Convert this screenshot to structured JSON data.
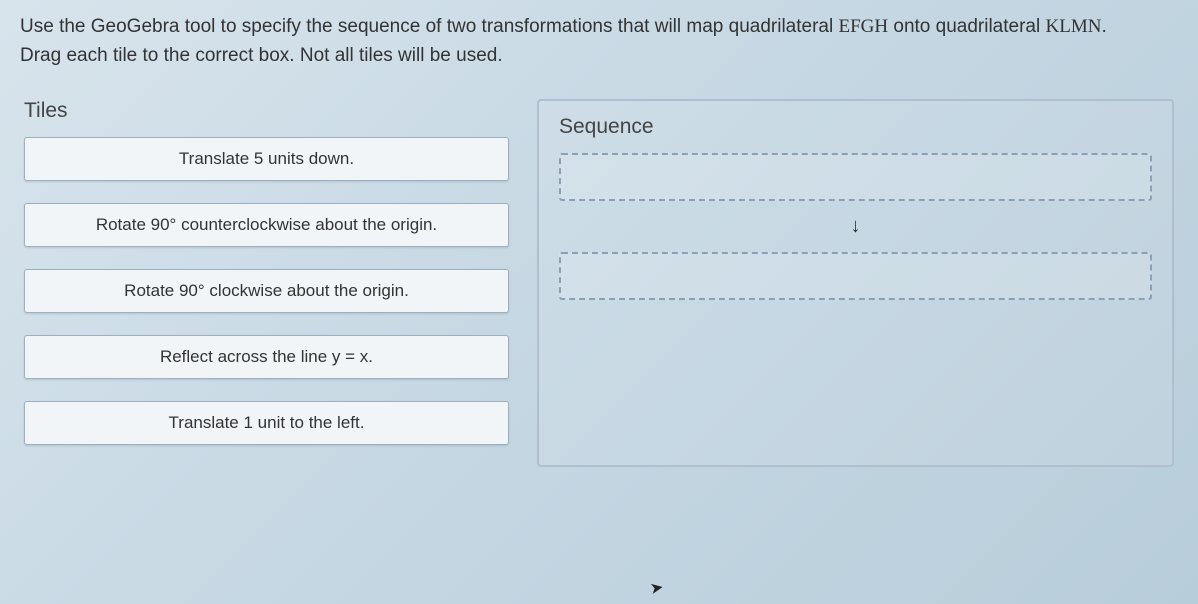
{
  "instructions": {
    "line1_pre": "Use the GeoGebra tool to specify the sequence of two transformations that will map quadrilateral ",
    "line1_shape1": "EFGH",
    "line1_mid": " onto quadrilateral ",
    "line1_shape2": "KLMN",
    "line1_post": ".",
    "line2": "Drag each tile to the correct box. Not all tiles will be used."
  },
  "tiles_label": "Tiles",
  "sequence_label": "Sequence",
  "arrow": "↓",
  "tiles": [
    "Translate 5 units down.",
    "Rotate 90° counterclockwise about the origin.",
    "Rotate 90° clockwise about the origin.",
    "Reflect across the line y = x.",
    "Translate 1 unit to the left."
  ]
}
